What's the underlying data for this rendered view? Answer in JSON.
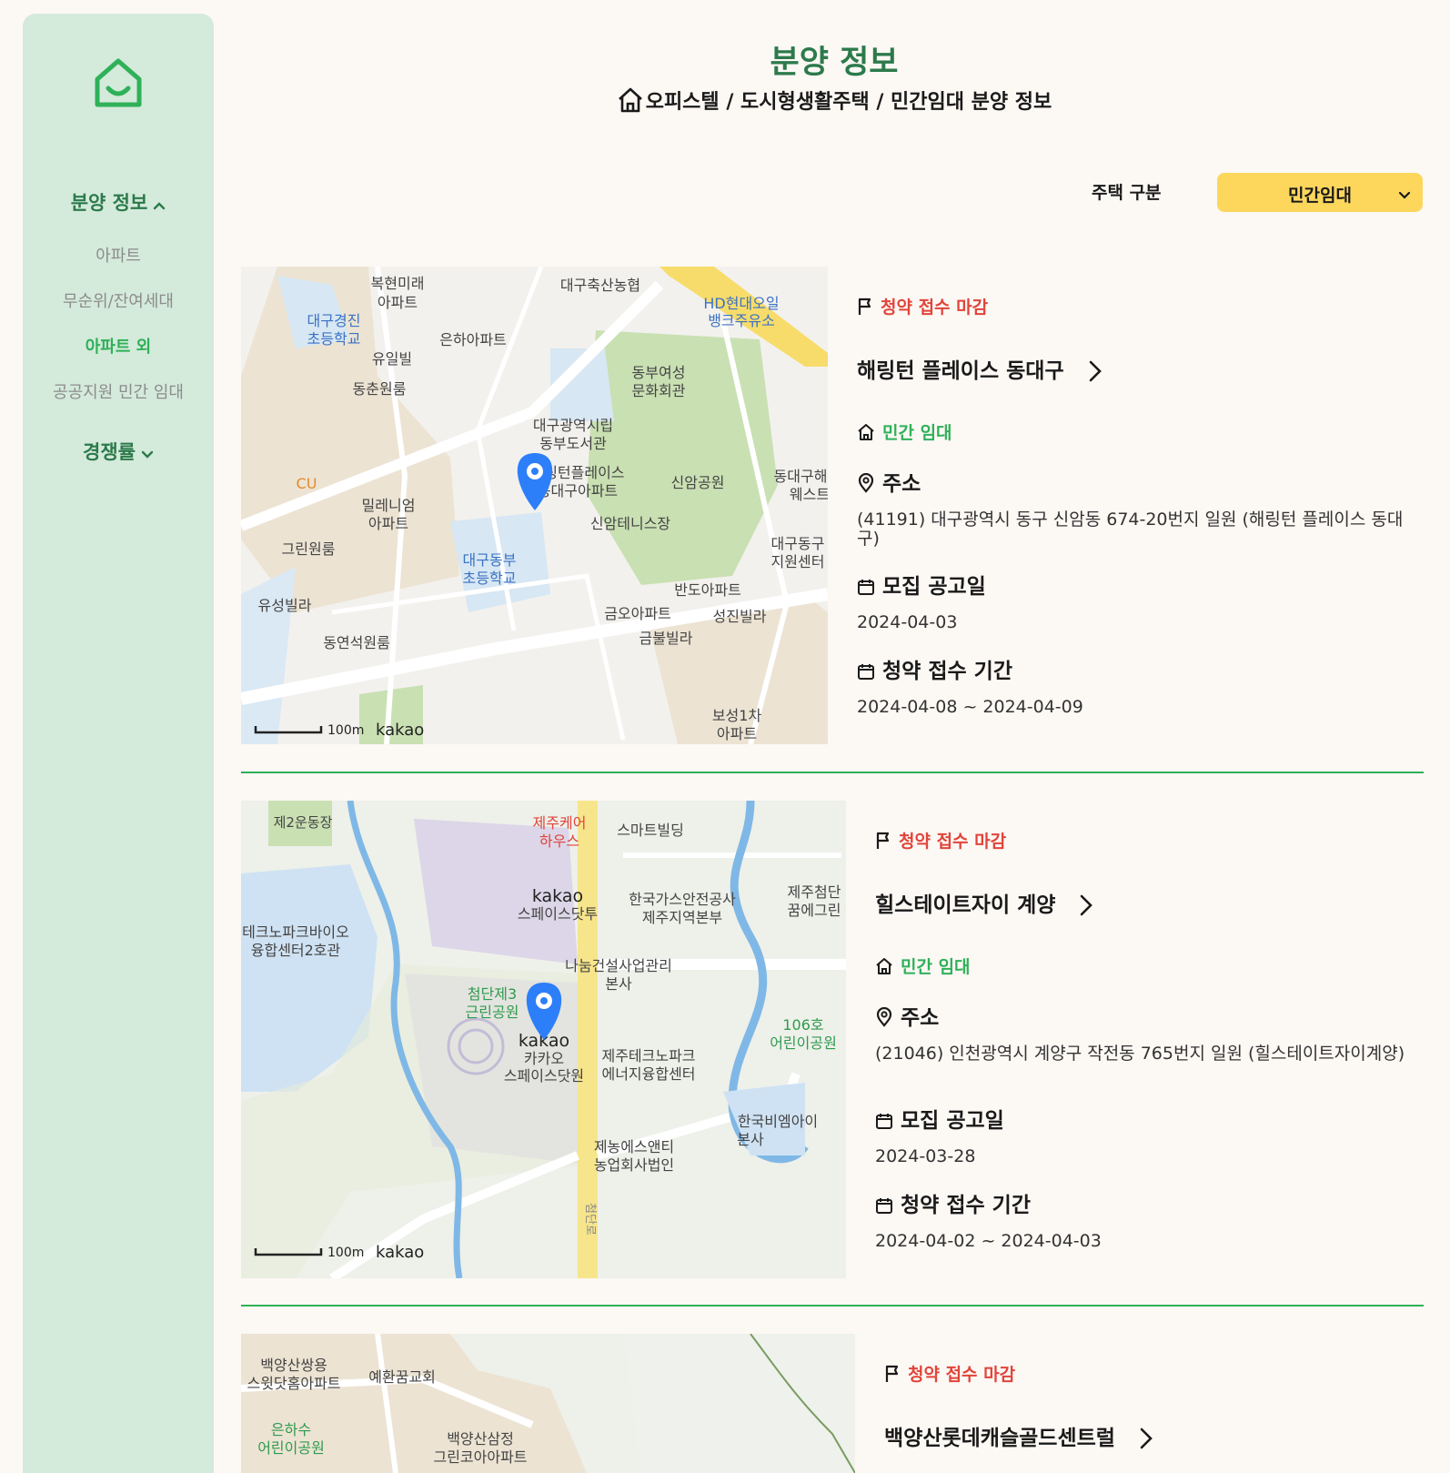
{
  "sidebar": {
    "section_title": "분양 정보",
    "items": [
      {
        "label": "아파트"
      },
      {
        "label": "무순위/잔여세대"
      },
      {
        "label": "아파트 외"
      },
      {
        "label": "공공지원 민간 임대"
      }
    ],
    "competition_title": "경쟁률"
  },
  "header": {
    "title": "분양 정보",
    "breadcrumb": "오피스텔 / 도시형생활주택 / 민간임대 분양 정보"
  },
  "filter": {
    "label": "주택 구분",
    "selected": "민간임대"
  },
  "listings": [
    {
      "status": "청약 접수 마감",
      "name": "해링턴 플레이스 동대구",
      "type": "민간 임대",
      "address_label": "주소",
      "address": "(41191) 대구광역시 동구 신암동 674-20번지 일원 (해링턴 플레이스 동대구)",
      "notice_label": "모집 공고일",
      "notice_date": "2024-04-03",
      "period_label": "청약 접수 기간",
      "period": "2024-04-08 ~ 2024-04-09",
      "map": {
        "scale": "100m",
        "brand": "kakao",
        "labels": [
          "복현미래 아파트",
          "대구축산농협",
          "HD현대오일 뱅크주유소",
          "대구경진 초등학교",
          "은하아파트",
          "유일빌",
          "동부여성 문화회관",
          "동춘원룸",
          "대구광역시립 동부도서관",
          "CU",
          "해링턴플레이스 동대구아파트",
          "신암공원",
          "동대구해 웨스트",
          "밀레니엄 아파트",
          "신암테니스장",
          "대구동구 지원센터",
          "그린원룸",
          "대구동부 초등학교",
          "반도아파트",
          "유성빌라",
          "금오아파트",
          "성진빌라",
          "동연석원룸",
          "금불빌라",
          "보성1차 아파트"
        ]
      }
    },
    {
      "status": "청약 접수 마감",
      "name": "힐스테이트자이 계양",
      "type": "민간 임대",
      "address_label": "주소",
      "address": "(21046) 인천광역시 계양구 작전동 765번지 일원 (힐스테이트자이계양)",
      "notice_label": "모집 공고일",
      "notice_date": "2024-03-28",
      "period_label": "청약 접수 기간",
      "period": "2024-04-02 ~ 2024-04-03",
      "map": {
        "scale": "100m",
        "brand": "kakao",
        "labels": [
          "제2운동장",
          "제주케어 하우스",
          "스마트빌딩",
          "kakao 스페이스닷투",
          "한국가스안전공사 제주지역본부",
          "제주첨단 꿈에그린",
          "테크노파크바이오 융합센터2호관",
          "나눔건설사업관리 본사",
          "첨단제3 근린공원",
          "106호 어린이공원",
          "kakao 카카오 스페이스닷원",
          "제주테크노파크 에너지융합센터",
          "한국비엠아이 본사",
          "제농에스앤티 농업회사법인",
          "첨단로"
        ]
      }
    },
    {
      "status": "청약 접수 마감",
      "name": "백양산롯데캐슬골드센트럴",
      "map": {
        "labels": [
          "백양산쌍용 스윗닷홈아파트",
          "예환꿈교회",
          "은하수 어린이공원",
          "백양산삼정 그린코아아파트"
        ]
      }
    }
  ],
  "colors": {
    "sidebar_bg": "#d4eadb",
    "accent_green": "#2fb158",
    "title_green": "#2c7a4b",
    "status_red": "#e1443a",
    "select_yellow": "#fdd75c",
    "page_bg": "#fcf8f4"
  },
  "icons": [
    "home-logo-icon",
    "chevron-up-icon",
    "chevron-down-icon",
    "home-icon",
    "flag-icon",
    "chevron-right-icon",
    "location-pin-icon",
    "calendar-icon"
  ]
}
